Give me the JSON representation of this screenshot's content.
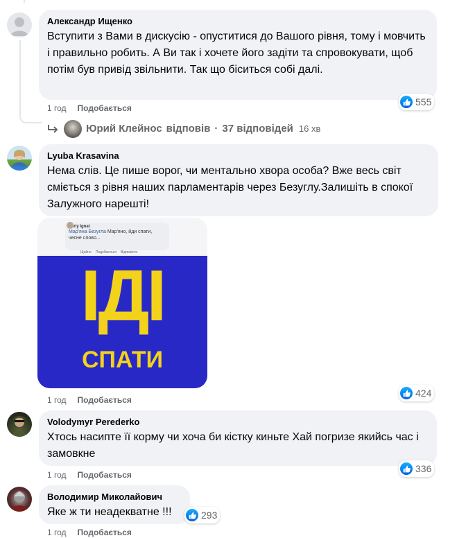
{
  "comments": [
    {
      "author": "Александр Ищенко",
      "text": "Вступити з Вами в дискусію - опуститися до Вашого рівня, тому і мовчить і правильно робить. А Ви так і хочете його задіти та спровокувати, щоб потім був привід звільнити. Так що біситься собі далі.",
      "time": "1 год",
      "like_label": "Подобається",
      "reactions": "555",
      "reply": {
        "author": "Юрий Клейнос",
        "action": "відповів",
        "separator": "·",
        "count_label": "37 відповідей",
        "time": "16 хв"
      }
    },
    {
      "author": "Lyuba Krasavina",
      "text": "Нема слів. Це пише ворог, чи ментально хвора особа? Вже весь світ сміється з рівня наших парламентарів через Безуглу.Залишіть в спокої Залужного нарешті!",
      "time": "1 год",
      "like_label": "Подобається",
      "reactions": "424",
      "image": {
        "inner_author": "Yuriy Ignat",
        "inner_mention": "Мар'яна Безугла",
        "inner_text": "Мар'яно, йди спати, чесне слово...",
        "inner_actions": [
          "Щойно",
          "Подобається",
          "Відповісти"
        ],
        "big_text": "ІДІ",
        "bottom_text": "СПАТИ",
        "colors": {
          "blue": "#2828c6",
          "yellow": "#f3d21c"
        }
      }
    },
    {
      "author": "Volodymyr Perederko",
      "text": "Хтось насипте її корму чи хоча би кістку киньте Хай погризе якийсь час і замовкне",
      "time": "1 год",
      "like_label": "Подобається",
      "reactions": "336"
    },
    {
      "author": "Володимир Миколайович",
      "text": "Яке ж ти неадекватне !!!",
      "time": "1 год",
      "like_label": "Подобається",
      "reactions": "293"
    }
  ],
  "colors": {
    "bubble": "#f0f2f5",
    "meta": "#65676b",
    "like_blue": "#1877f2"
  },
  "icons": {
    "reply_arrow": "reply-arrow-icon",
    "reaction": "thumbs-up-icon"
  }
}
